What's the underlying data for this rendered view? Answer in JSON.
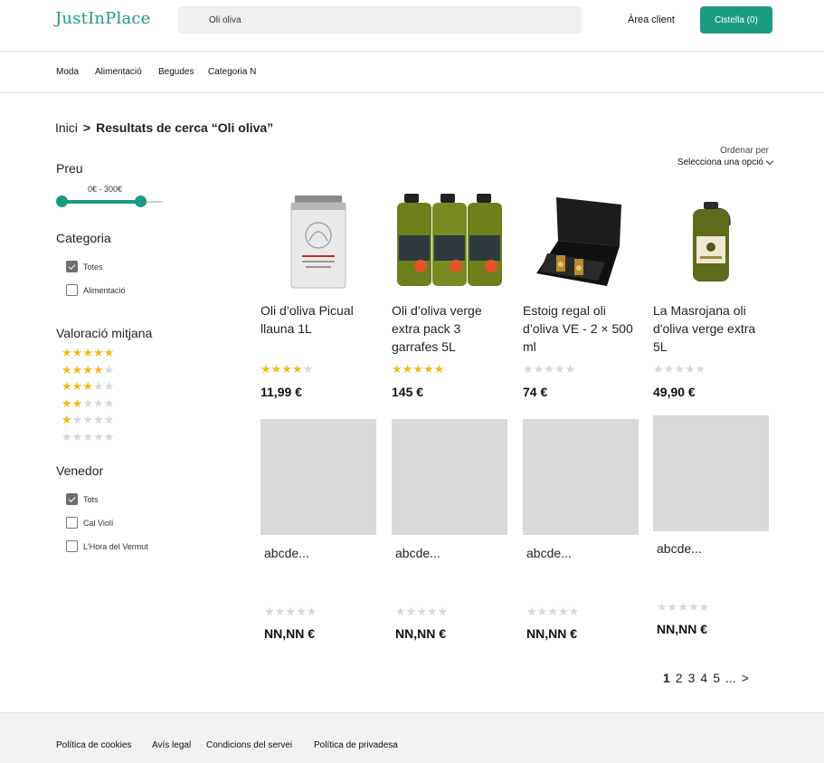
{
  "header": {
    "logo": "JustInPlace",
    "search_value": "Oli oliva",
    "area_client": "Àrea client",
    "cart_label": "Cistella (0)"
  },
  "nav": [
    "Moda",
    "Alimentació",
    "Begudes",
    "Categoria N"
  ],
  "breadcrumb": {
    "home": "Inici",
    "separator": ">",
    "current": "Resultats de cerca “Oli oliva”"
  },
  "sort": {
    "label": "Ordenar per",
    "value": "Selecciona una opció"
  },
  "filters": {
    "price": {
      "title": "Preu",
      "range": "0€ - 300€"
    },
    "category": {
      "title": "Categoria",
      "options": [
        {
          "label": "Totes",
          "checked": true
        },
        {
          "label": "Alimentació",
          "checked": false
        }
      ]
    },
    "rating": {
      "title": "Valoració mitjana",
      "levels": [
        5,
        4,
        3,
        2,
        1,
        0
      ]
    },
    "seller": {
      "title": "Venedor",
      "options": [
        {
          "label": "Tots",
          "checked": true
        },
        {
          "label": "Cal Violí",
          "checked": false
        },
        {
          "label": "L'Hora del Vermut",
          "checked": false
        }
      ]
    }
  },
  "products": [
    {
      "name": "Oli d’oliva Picual llauna 1L",
      "rating": 4,
      "price": "11,99 €",
      "image": "olive-oil-tin"
    },
    {
      "name": "Oli d’oliva verge extra pack 3 garrafes 5L",
      "rating": 5,
      "price": "145 €",
      "image": "olive-oil-jugs-pack"
    },
    {
      "name": "Estoig regal oli d’oliva VE - 2 × 500 ml",
      "rating": 0,
      "price": "74 €",
      "image": "gift-box-bottles"
    },
    {
      "name": "La Masrojana oli d'oliva verge extra 5L",
      "rating": 0,
      "price": "49,90 €",
      "image": "olive-oil-jug"
    }
  ],
  "placeholders": [
    {
      "name": "abcde...",
      "rating": 0,
      "price": "NN,NN €"
    },
    {
      "name": "abcde...",
      "rating": 0,
      "price": "NN,NN €"
    },
    {
      "name": "abcde...",
      "rating": 0,
      "price": "NN,NN €"
    },
    {
      "name": "abcde...",
      "rating": 0,
      "price": "NN,NN €"
    }
  ],
  "pagination": {
    "pages": [
      "1",
      "2",
      "3",
      "4",
      "5",
      "..."
    ],
    "active": "1",
    "next": ">"
  },
  "footer": [
    "Política de cookies",
    "Avís legal",
    "Condicions del servei",
    "Política de privadesa"
  ],
  "colors": {
    "accent": "#1a9b82",
    "star": "#f3b91c",
    "placeholder": "#d9d9d9"
  }
}
